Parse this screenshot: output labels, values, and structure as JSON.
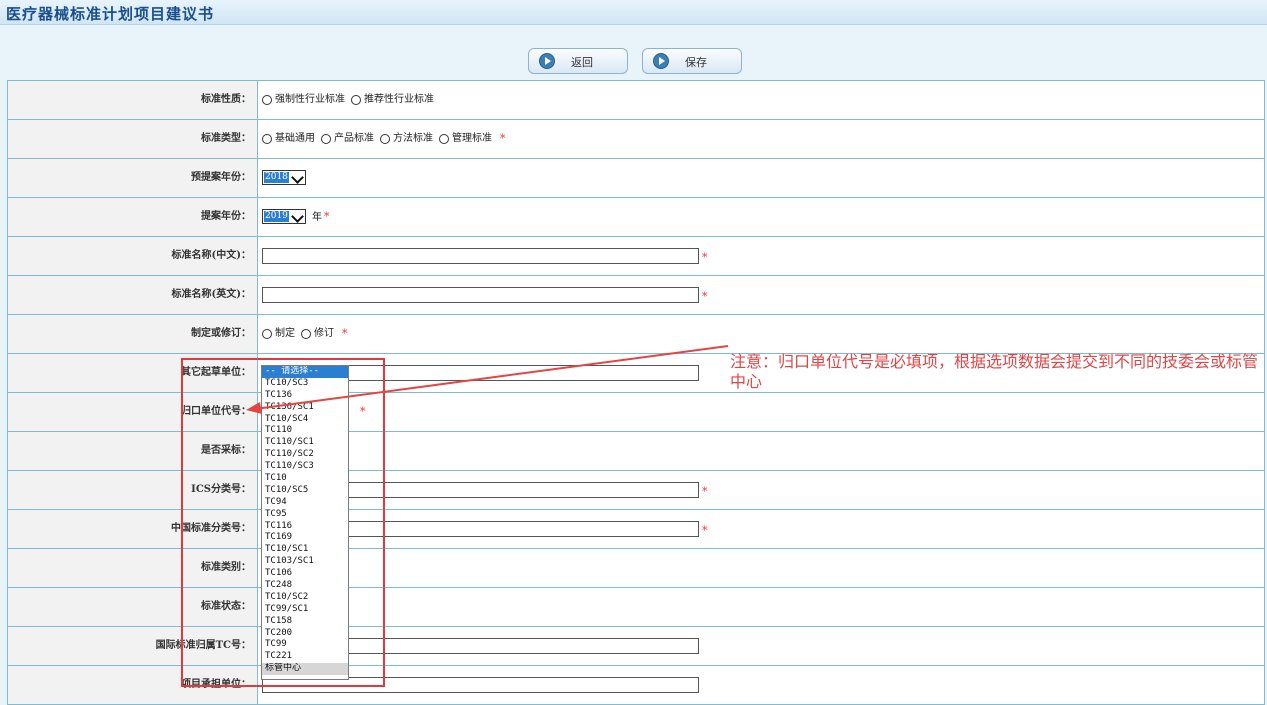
{
  "page": {
    "title": "医疗器械标准计划项目建议书"
  },
  "toolbar": {
    "back_label": "返回",
    "save_label": "保存"
  },
  "form": {
    "rows": [
      {
        "label": "标准性质：",
        "type": "radio",
        "options": [
          "强制性行业标准",
          "推荐性行业标准"
        ],
        "required": false
      },
      {
        "label": "标准类型：",
        "type": "radio",
        "options": [
          "基础通用",
          "产品标准",
          "方法标准",
          "管理标准"
        ],
        "required": true
      },
      {
        "label": "预提案年份：",
        "type": "select",
        "value": "2018"
      },
      {
        "label": "提案年份：",
        "type": "select",
        "value": "2019",
        "suffix": "年"
      },
      {
        "label": "标准名称(中文)：",
        "type": "text",
        "required": true
      },
      {
        "label": "标准名称(英文)：",
        "type": "text",
        "required": true
      },
      {
        "label": "制定或修订：",
        "type": "radio",
        "options": [
          "制定",
          "修订"
        ],
        "required": true
      },
      {
        "label": "其它起草单位：",
        "type": "text",
        "required": false
      },
      {
        "label": "归口单位代号：",
        "type": "dropdown",
        "required": true
      },
      {
        "label": "是否采标：",
        "type": "empty"
      },
      {
        "label": "ICS分类号：",
        "type": "text",
        "required": true
      },
      {
        "label": "中国标准分类号：",
        "type": "text",
        "required": true
      },
      {
        "label": "标准类别：",
        "type": "empty"
      },
      {
        "label": "标准状态：",
        "type": "empty"
      },
      {
        "label": "国际标准归属TC号：",
        "type": "text",
        "required": false
      },
      {
        "label": "项目承担单位：",
        "type": "text",
        "required": false
      }
    ],
    "required_mark": "*"
  },
  "dropdown": {
    "options": [
      "-- 请选择--",
      "TC10/SC3",
      "TC136",
      "TC136/SC1",
      "TC10/SC4",
      "TC110",
      "TC110/SC1",
      "TC110/SC2",
      "TC110/SC3",
      "TC10",
      "TC10/SC5",
      "TC94",
      "TC95",
      "TC116",
      "TC169",
      "TC10/SC1",
      "TC103/SC1",
      "TC106",
      "TC248",
      "TC10/SC2",
      "TC99/SC1",
      "TC158",
      "TC200",
      "TC99",
      "TC221",
      "标管中心"
    ],
    "selected_index": 0,
    "highlighted_index": 25
  },
  "annotation": {
    "text": "注意：归口单位代号是必填项，根据选项数据会提交到不同的技委会或标管中心",
    "color": "#e34545"
  },
  "colors": {
    "title": "#1a4e8c",
    "border": "#7fbcd3",
    "required": "#e33333",
    "selection": "#2a7fd0"
  }
}
